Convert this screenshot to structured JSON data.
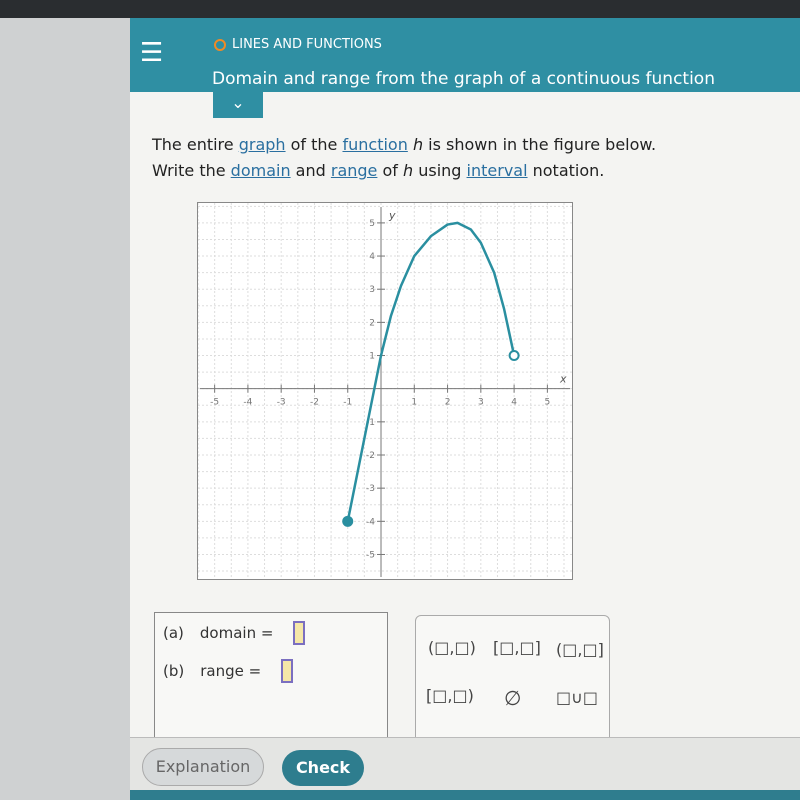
{
  "header": {
    "topic": "LINES AND FUNCTIONS",
    "title": "Domain and range from the graph of a continuous function",
    "menu_icon": "hamburger-icon",
    "collapse_icon": "chevron-down-icon"
  },
  "prompt": {
    "l1a": "The entire ",
    "graph": "graph",
    "l1b": " of the ",
    "function": "function",
    "h1": "h",
    "l1c": " is shown in the figure below.",
    "l2a": "Write the ",
    "domain": "domain",
    "l2b": " and ",
    "range": "range",
    "l2c": " of ",
    "h2": "h",
    "l2d": " using ",
    "interval": "interval",
    "l2e": " notation."
  },
  "chart_data": {
    "type": "line",
    "xlabel": "x",
    "ylabel": "y",
    "xlim": [
      -5.5,
      5.8
    ],
    "ylim": [
      -5.8,
      5.6
    ],
    "xticks": [
      -5,
      -4,
      -3,
      -2,
      -1,
      1,
      2,
      3,
      4,
      5
    ],
    "yticks": [
      -5,
      -4,
      -3,
      -2,
      -1,
      1,
      2,
      3,
      4,
      5
    ],
    "grid": true,
    "color": "#2a8fa0",
    "points": [
      [
        -1,
        -4
      ],
      [
        -0.6,
        -2
      ],
      [
        -0.2,
        0
      ],
      [
        0,
        1
      ],
      [
        0.3,
        2.2
      ],
      [
        0.6,
        3.1
      ],
      [
        1,
        4
      ],
      [
        1.5,
        4.6
      ],
      [
        2,
        4.95
      ],
      [
        2.3,
        5
      ],
      [
        2.7,
        4.8
      ],
      [
        3,
        4.4
      ],
      [
        3.4,
        3.5
      ],
      [
        3.7,
        2.4
      ],
      [
        4,
        1
      ]
    ],
    "endpoints": [
      {
        "x": -1,
        "y": -4,
        "closed": true
      },
      {
        "x": 4,
        "y": 1,
        "closed": false
      }
    ]
  },
  "answers": {
    "a": "(a)",
    "domain": "domain =",
    "b": "(b)",
    "range": "range ="
  },
  "palette": [
    "(□,□)",
    "[□,□]",
    "(□,□]",
    "[□,□)",
    "∅",
    "□∪□"
  ],
  "buttons": {
    "explanation": "Explanation",
    "check": "Check"
  }
}
